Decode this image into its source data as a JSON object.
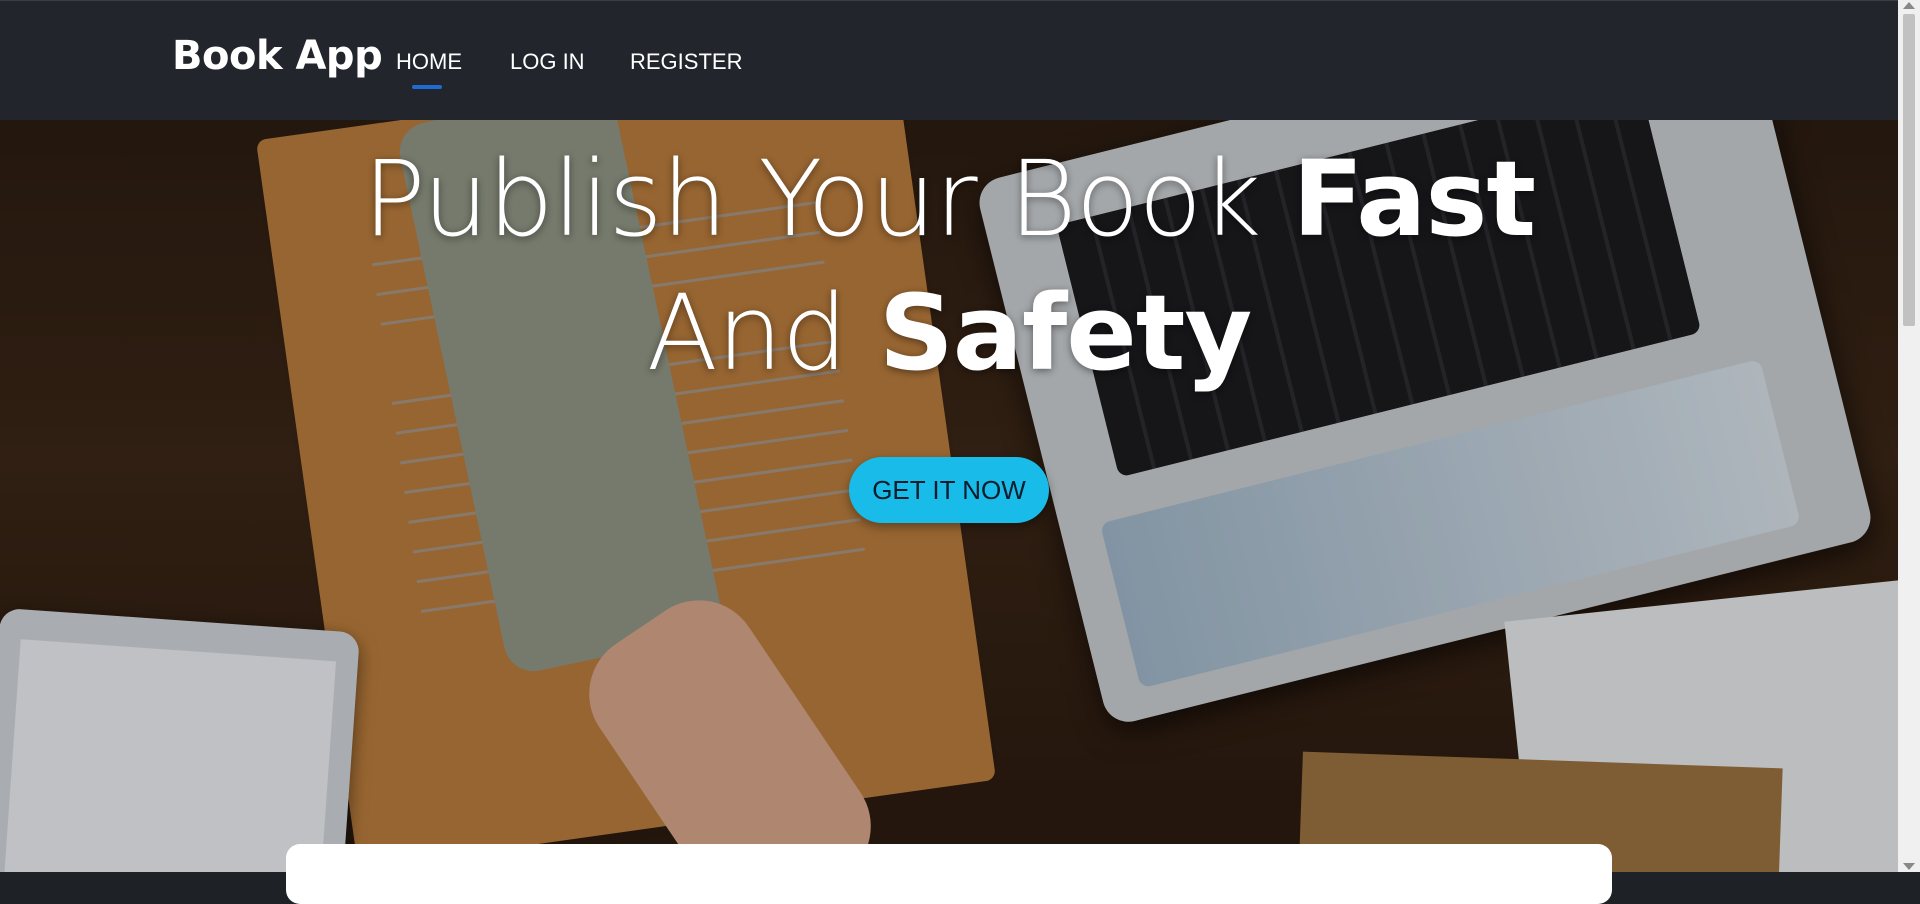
{
  "navbar": {
    "brand": "Book App",
    "links": [
      {
        "label": "HOME",
        "active": true
      },
      {
        "label": "LOG IN",
        "active": false
      },
      {
        "label": "REGISTER",
        "active": false
      }
    ],
    "active_indicator_color": "#1e6bd6",
    "background": "#22262c"
  },
  "hero": {
    "headline_line1_light": "Publish Your Book ",
    "headline_line1_bold": "Fast",
    "headline_line2_light": "And ",
    "headline_line2_bold": "Safety",
    "cta_label": "GET IT NOW",
    "cta_color": "#19bbe8"
  }
}
